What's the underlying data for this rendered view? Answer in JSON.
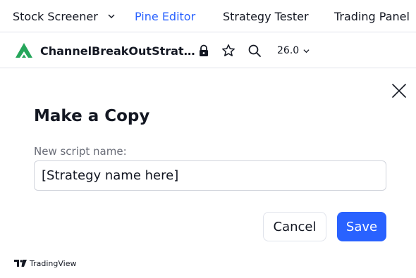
{
  "tabs": {
    "screener": "Stock Screener",
    "pine": "Pine Editor",
    "strategy": "Strategy Tester",
    "panel": "Trading Panel"
  },
  "toolbar": {
    "script_name": "ChannelBreakOutStrat…",
    "font_size": "26.0"
  },
  "dialog": {
    "title": "Make a Copy",
    "field_label": "New script name:",
    "field_value": "[Strategy name here]",
    "cancel_label": "Cancel",
    "save_label": "Save"
  },
  "footer": {
    "brand": "TradingView"
  },
  "colors": {
    "accent": "#2962ff",
    "text": "#131722",
    "muted": "#6a6d78",
    "border": "#e0e3eb",
    "logo_green": "#26a65b"
  },
  "icons": [
    "chevron-down-icon",
    "script-logo-icon",
    "lock-icon",
    "star-icon",
    "search-icon",
    "close-icon",
    "tradingview-logo-icon"
  ]
}
